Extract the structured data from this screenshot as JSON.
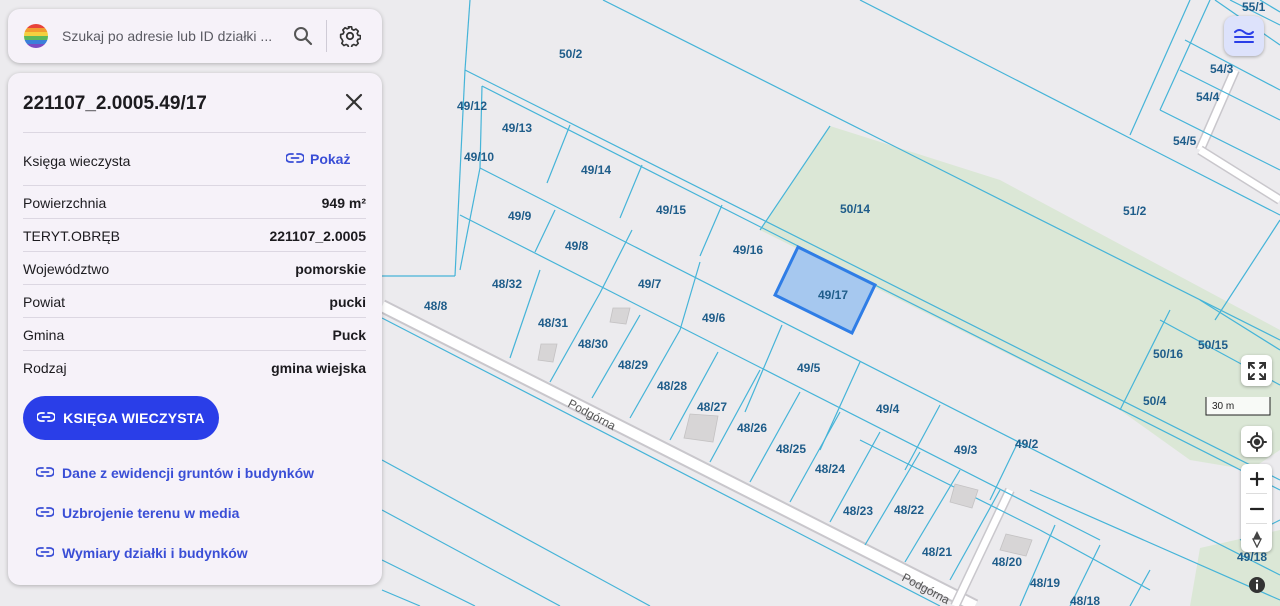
{
  "search": {
    "placeholder": "Szukaj po adresie lub ID działki ...",
    "value": "",
    "logo_icon": "rainbow-logo-icon",
    "search_icon": "search-icon",
    "settings_icon": "gear-icon"
  },
  "panel": {
    "title": "221107_2.0005.49/17",
    "close_icon": "close-icon",
    "land_register": {
      "label": "Księga wieczysta",
      "action": "Pokaż",
      "action_icon": "link-icon"
    },
    "rows": [
      {
        "label": "Powierzchnia",
        "value": "949 m²"
      },
      {
        "label": "TERYT.OBRĘB",
        "value": "221107_2.0005"
      },
      {
        "label": "Województwo",
        "value": "pomorskie"
      },
      {
        "label": "Powiat",
        "value": "pucki"
      },
      {
        "label": "Gmina",
        "value": "Puck"
      },
      {
        "label": "Rodzaj",
        "value": "gmina wiejska"
      }
    ],
    "primary_button": {
      "label": "KSIĘGA WIECZYSTA",
      "icon": "link-icon"
    },
    "links": [
      {
        "label": "Dane z ewidencji gruntów i budynków",
        "icon": "link-icon"
      },
      {
        "label": "Uzbrojenie terenu w media",
        "icon": "link-icon"
      },
      {
        "label": "Wymiary działki i budynków",
        "icon": "link-icon"
      }
    ]
  },
  "map": {
    "parcel_labels": [
      "50/2",
      "49/12",
      "49/13",
      "49/10",
      "49/14",
      "49/9",
      "49/15",
      "49/8",
      "49/16",
      "50/14",
      "51/2",
      "49/7",
      "49/17",
      "48/32",
      "48/8",
      "48/31",
      "49/6",
      "48/30",
      "48/29",
      "49/5",
      "48/28",
      "49/4",
      "48/27",
      "48/26",
      "48/25",
      "49/3",
      "49/2",
      "48/24",
      "48/23",
      "48/22",
      "48/21",
      "48/20",
      "48/19",
      "48/18",
      "55/1",
      "54/3",
      "54/4",
      "54/5",
      "50/15",
      "50/16",
      "50/4",
      "49/18"
    ],
    "selected_parcel": "49/17",
    "street_name": "Podgórna",
    "scale_label": "30 m",
    "colors": {
      "background": "#ecebee",
      "parcel_line": "#45b4d8",
      "selected_fill": "#9ac2ee",
      "selected_stroke": "#2f7de6",
      "green_area": "#dbe7d6",
      "accent": "#2a3ee8"
    }
  },
  "controls": {
    "layers_icon": "layers-icon",
    "fullscreen_icon": "fullscreen-icon",
    "locate_icon": "crosshair-icon",
    "zoom_in_icon": "plus-icon",
    "zoom_out_icon": "minus-icon",
    "compass_icon": "compass-icon",
    "info_icon": "info-icon"
  }
}
